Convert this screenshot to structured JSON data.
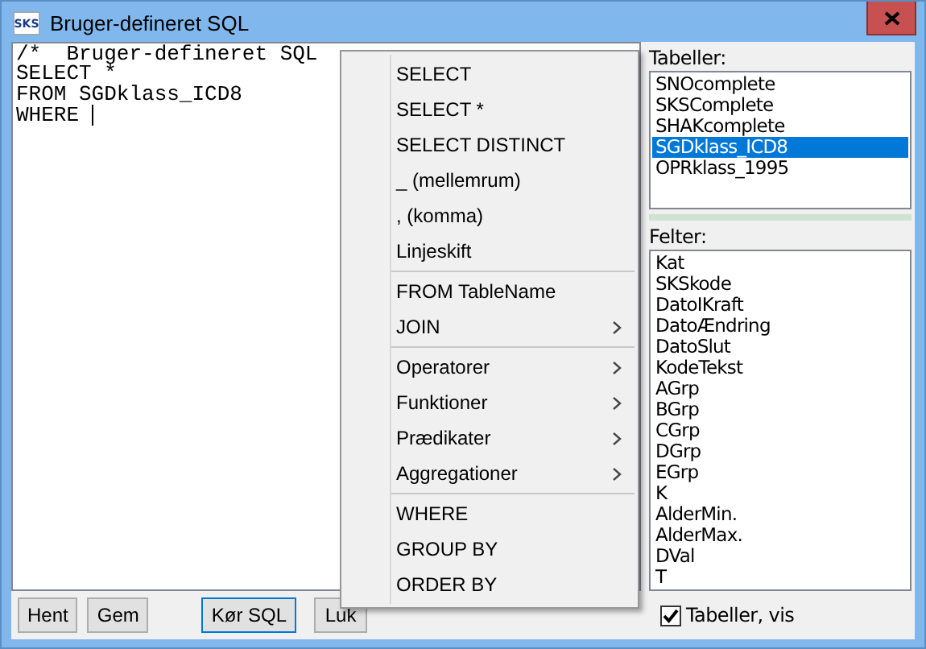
{
  "window": {
    "title": "Bruger-defineret SQL",
    "icon_text": "SKS"
  },
  "editor": {
    "lines": [
      "/*  Bruger-defineret SQL",
      "SELECT *",
      "FROM SGDklass_ICD8",
      "WHERE "
    ],
    "cursor": true
  },
  "tables": {
    "label": "Tabeller:",
    "items": [
      {
        "name": "SNOcomplete",
        "selected": false
      },
      {
        "name": "SKSComplete",
        "selected": false
      },
      {
        "name": "SHAKcomplete",
        "selected": false
      },
      {
        "name": "SGDklass_ICD8",
        "selected": true
      },
      {
        "name": "OPRklass_1995",
        "selected": false
      }
    ]
  },
  "fields": {
    "label": "Felter:",
    "items": [
      "Kat",
      "SKSkode",
      "DatoIKraft",
      "DatoÆndring",
      "DatoSlut",
      "KodeTekst",
      "AGrp",
      "BGrp",
      "CGrp",
      "DGrp",
      "EGrp",
      "K",
      "AlderMin.",
      "AlderMax.",
      "DVal",
      "T"
    ]
  },
  "buttons": [
    {
      "label": "Hent",
      "focused": false
    },
    {
      "label": "Gem",
      "focused": false
    },
    {
      "label": "Kør SQL",
      "focused": true
    },
    {
      "label": "Luk",
      "focused": false
    }
  ],
  "show_tables": {
    "label": "Tabeller, vis",
    "checked": true
  },
  "context_menu": {
    "groups": [
      [
        {
          "label": "SELECT",
          "submenu": false
        },
        {
          "label": "SELECT *",
          "submenu": false
        },
        {
          "label": "SELECT DISTINCT",
          "submenu": false
        },
        {
          "label": "_ (mellemrum)",
          "submenu": false
        },
        {
          "label": ", (komma)",
          "submenu": false
        },
        {
          "label": "Linjeskift",
          "submenu": false
        }
      ],
      [
        {
          "label": "FROM TableName",
          "submenu": false
        },
        {
          "label": "JOIN",
          "submenu": true
        }
      ],
      [
        {
          "label": "Operatorer",
          "submenu": true
        },
        {
          "label": "Funktioner",
          "submenu": true
        },
        {
          "label": "Prædikater",
          "submenu": true
        },
        {
          "label": "Aggregationer",
          "submenu": true
        }
      ],
      [
        {
          "label": "WHERE",
          "submenu": false
        },
        {
          "label": "GROUP BY",
          "submenu": false
        },
        {
          "label": "ORDER BY",
          "submenu": false
        }
      ]
    ]
  }
}
